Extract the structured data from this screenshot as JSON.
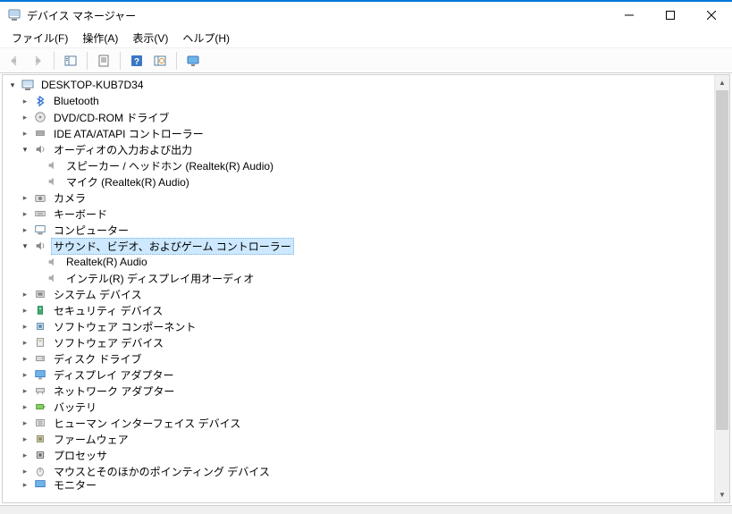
{
  "titlebar": {
    "title": "デバイス マネージャー"
  },
  "menubar": {
    "file": "ファイル(F)",
    "action": "操作(A)",
    "view": "表示(V)",
    "help": "ヘルプ(H)"
  },
  "tree": {
    "root": "DESKTOP-KUB7D34",
    "bluetooth": "Bluetooth",
    "dvd": "DVD/CD-ROM ドライブ",
    "ide": "IDE ATA/ATAPI コントローラー",
    "audio_io": "オーディオの入力および出力",
    "audio_io_children": {
      "speaker": "スピーカー / ヘッドホン (Realtek(R) Audio)",
      "mic": "マイク (Realtek(R) Audio)"
    },
    "camera": "カメラ",
    "keyboard": "キーボード",
    "computer": "コンピューター",
    "sound_video_game": "サウンド、ビデオ、およびゲーム コントローラー",
    "sound_video_game_children": {
      "realtek": "Realtek(R) Audio",
      "intel_display_audio": "インテル(R) ディスプレイ用オーディオ"
    },
    "system_devices": "システム デバイス",
    "security_devices": "セキュリティ デバイス",
    "software_components": "ソフトウェア コンポーネント",
    "software_devices": "ソフトウェア デバイス",
    "disk_drives": "ディスク ドライブ",
    "display_adapters": "ディスプレイ アダプター",
    "network_adapters": "ネットワーク アダプター",
    "battery": "バッテリ",
    "hid": "ヒューマン インターフェイス デバイス",
    "firmware": "ファームウェア",
    "processor": "プロセッサ",
    "mice": "マウスとそのほかのポインティング デバイス",
    "monitor": "モニター"
  }
}
